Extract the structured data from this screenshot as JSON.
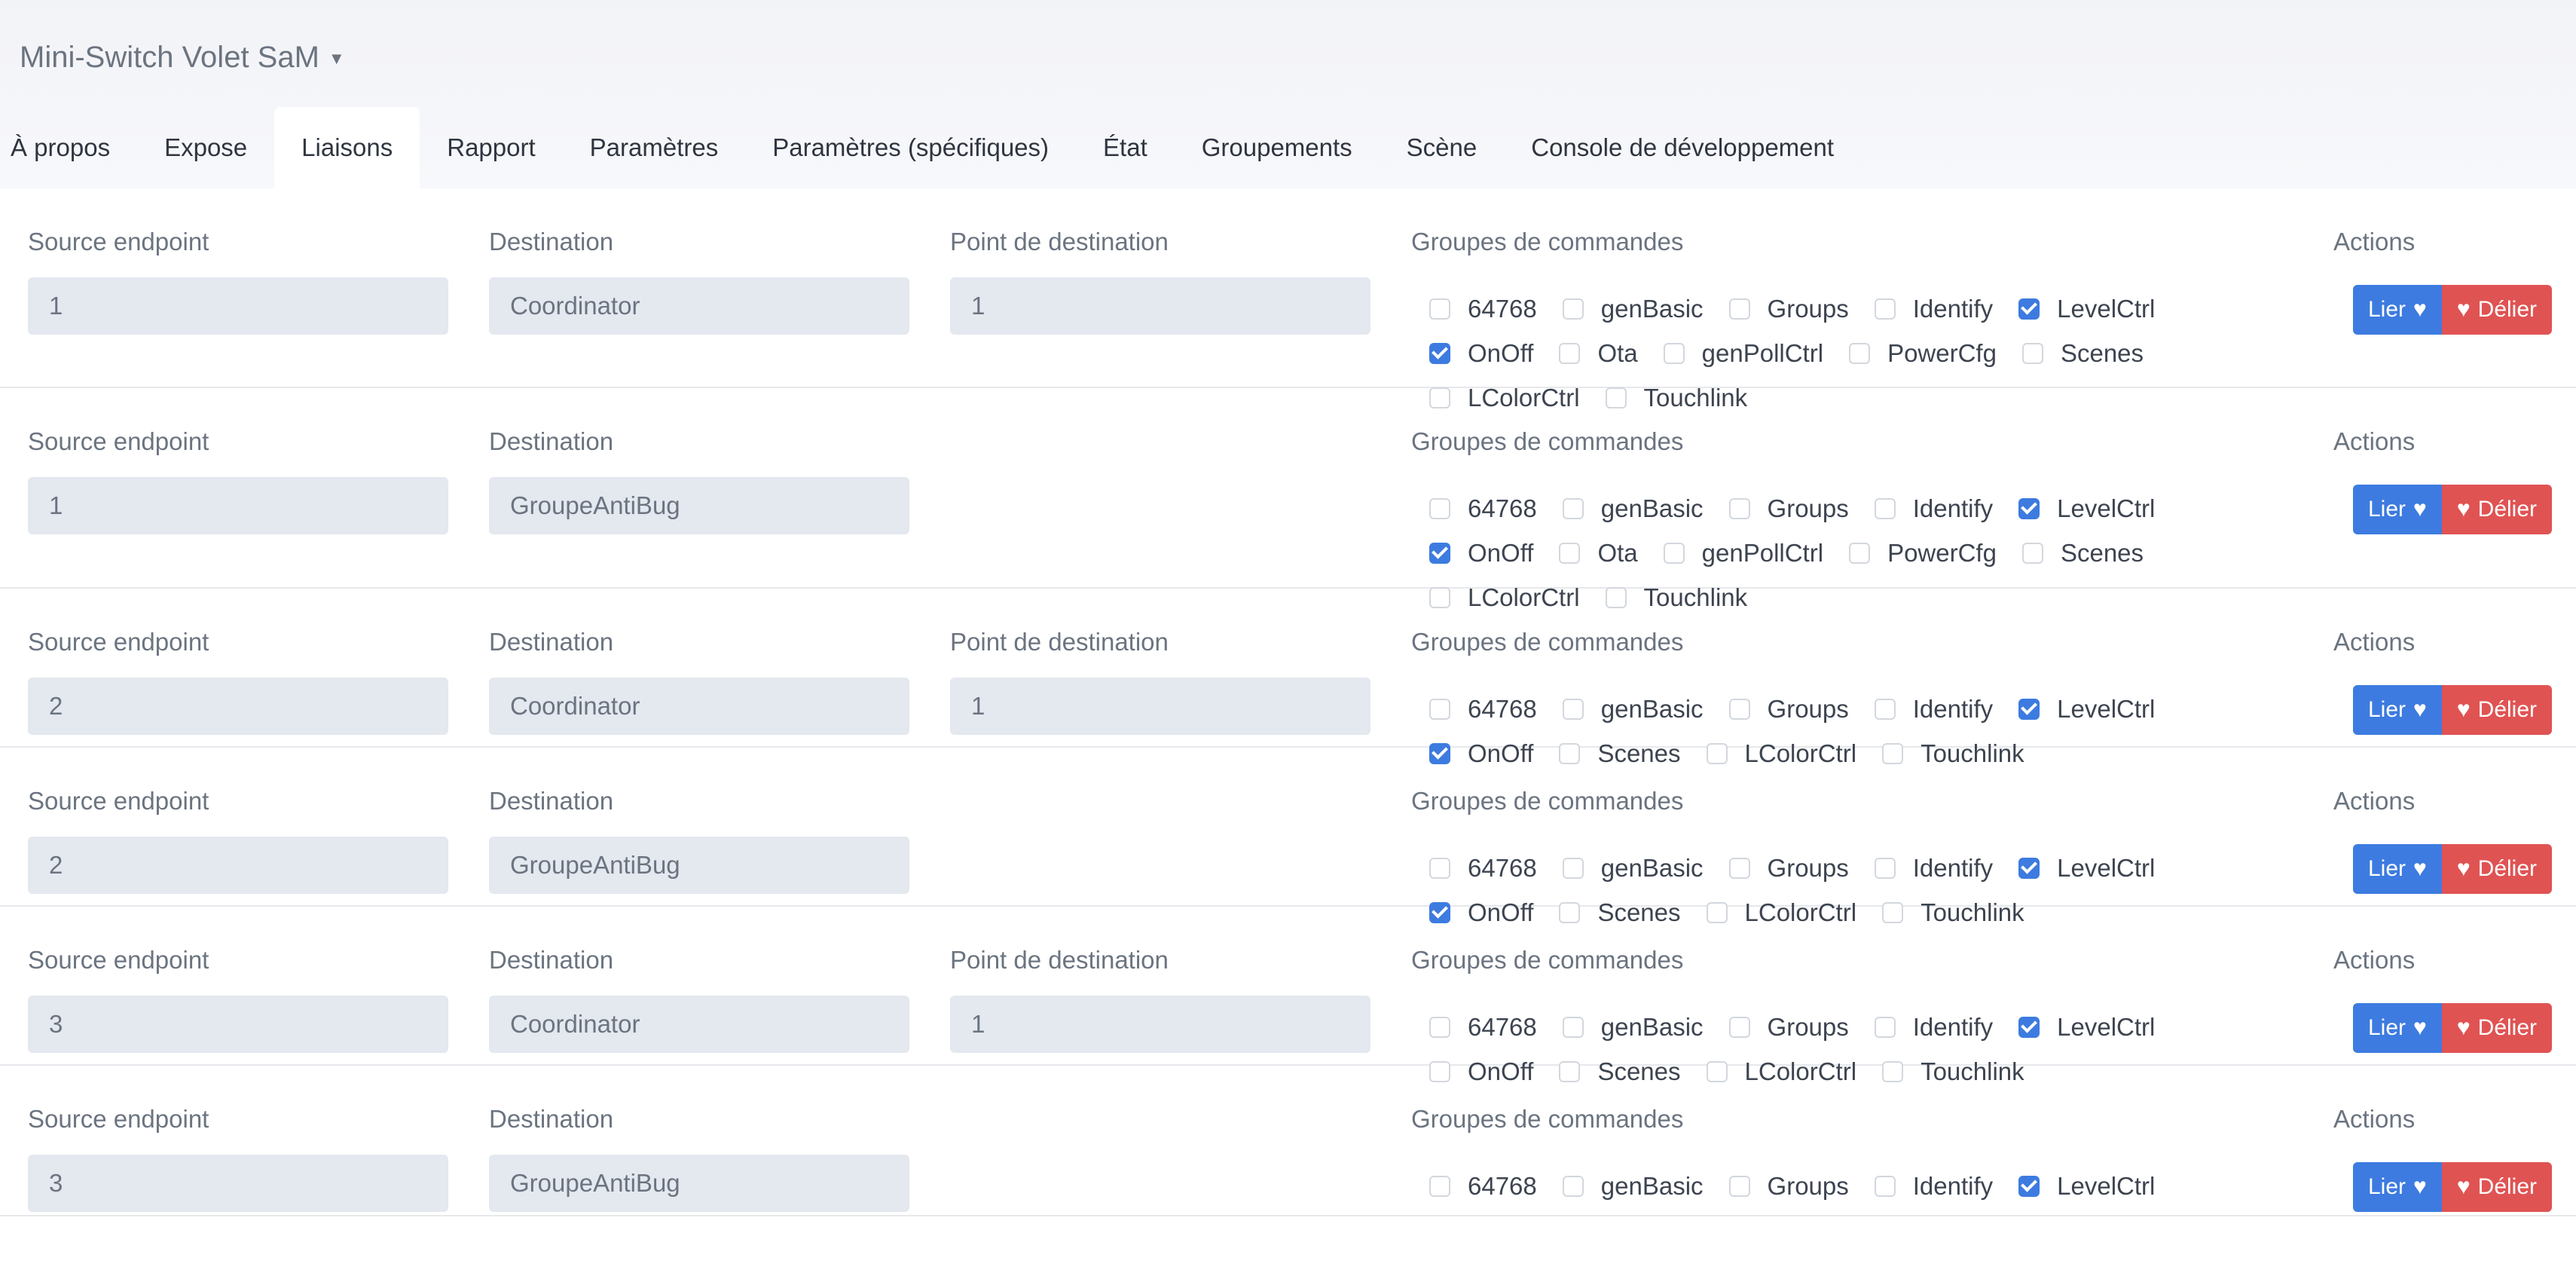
{
  "device": {
    "title": "Mini-Switch Volet SaM"
  },
  "tabs": [
    {
      "label": "À propos"
    },
    {
      "label": "Expose"
    },
    {
      "label": "Liaisons",
      "active": true
    },
    {
      "label": "Rapport"
    },
    {
      "label": "Paramètres"
    },
    {
      "label": "Paramètres (spécifiques)"
    },
    {
      "label": "État"
    },
    {
      "label": "Groupements"
    },
    {
      "label": "Scène"
    },
    {
      "label": "Console de développement"
    }
  ],
  "labels": {
    "source_endpoint": "Source endpoint",
    "destination": "Destination",
    "dest_endpoint": "Point de destination",
    "command_groups": "Groupes de commandes",
    "actions": "Actions",
    "bind": "Lier",
    "unbind": "Délier"
  },
  "icons": {
    "bind": "heart-icon",
    "unbind": "broken-heart-icon",
    "title": "chevron-down-icon"
  },
  "colors": {
    "primary": "#3d7be0",
    "danger": "#e05353"
  },
  "bindings": [
    {
      "source": "1",
      "destination": "Coordinator",
      "dest_endpoint": "1",
      "groups": [
        [
          [
            "64768",
            false
          ],
          [
            "genBasic",
            false
          ],
          [
            "Groups",
            false
          ],
          [
            "Identify",
            false
          ],
          [
            "LevelCtrl",
            true
          ]
        ],
        [
          [
            "OnOff",
            true
          ],
          [
            "Ota",
            false
          ],
          [
            "genPollCtrl",
            false
          ],
          [
            "PowerCfg",
            false
          ],
          [
            "Scenes",
            false
          ]
        ],
        [
          [
            "LColorCtrl",
            false
          ],
          [
            "Touchlink",
            false
          ]
        ]
      ]
    },
    {
      "source": "1",
      "destination": "GroupeAntiBug",
      "dest_endpoint": null,
      "groups": [
        [
          [
            "64768",
            false
          ],
          [
            "genBasic",
            false
          ],
          [
            "Groups",
            false
          ],
          [
            "Identify",
            false
          ],
          [
            "LevelCtrl",
            true
          ]
        ],
        [
          [
            "OnOff",
            true
          ],
          [
            "Ota",
            false
          ],
          [
            "genPollCtrl",
            false
          ],
          [
            "PowerCfg",
            false
          ],
          [
            "Scenes",
            false
          ]
        ],
        [
          [
            "LColorCtrl",
            false
          ],
          [
            "Touchlink",
            false
          ]
        ]
      ]
    },
    {
      "source": "2",
      "destination": "Coordinator",
      "dest_endpoint": "1",
      "groups": [
        [
          [
            "64768",
            false
          ],
          [
            "genBasic",
            false
          ],
          [
            "Groups",
            false
          ],
          [
            "Identify",
            false
          ],
          [
            "LevelCtrl",
            true
          ]
        ],
        [
          [
            "OnOff",
            true
          ],
          [
            "Scenes",
            false
          ],
          [
            "LColorCtrl",
            false
          ],
          [
            "Touchlink",
            false
          ]
        ]
      ]
    },
    {
      "source": "2",
      "destination": "GroupeAntiBug",
      "dest_endpoint": null,
      "groups": [
        [
          [
            "64768",
            false
          ],
          [
            "genBasic",
            false
          ],
          [
            "Groups",
            false
          ],
          [
            "Identify",
            false
          ],
          [
            "LevelCtrl",
            true
          ]
        ],
        [
          [
            "OnOff",
            true
          ],
          [
            "Scenes",
            false
          ],
          [
            "LColorCtrl",
            false
          ],
          [
            "Touchlink",
            false
          ]
        ]
      ]
    },
    {
      "source": "3",
      "destination": "Coordinator",
      "dest_endpoint": "1",
      "groups": [
        [
          [
            "64768",
            false
          ],
          [
            "genBasic",
            false
          ],
          [
            "Groups",
            false
          ],
          [
            "Identify",
            false
          ],
          [
            "LevelCtrl",
            true
          ]
        ],
        [
          [
            "OnOff",
            false
          ],
          [
            "Scenes",
            false
          ],
          [
            "LColorCtrl",
            false
          ],
          [
            "Touchlink",
            false
          ]
        ]
      ]
    },
    {
      "source": "3",
      "destination": "GroupeAntiBug",
      "dest_endpoint": null,
      "groups": [
        [
          [
            "64768",
            false
          ],
          [
            "genBasic",
            false
          ],
          [
            "Groups",
            false
          ],
          [
            "Identify",
            false
          ],
          [
            "LevelCtrl",
            true
          ]
        ]
      ]
    }
  ]
}
